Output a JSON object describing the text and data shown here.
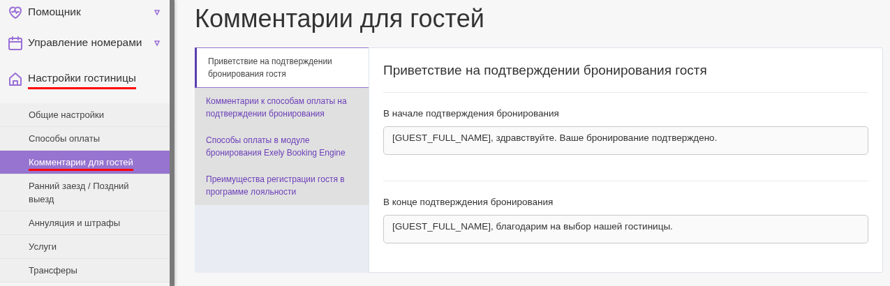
{
  "sidebar": {
    "sections": [
      {
        "label": "Помощник",
        "caret": true,
        "underlined": false
      },
      {
        "label": "Управление номерами",
        "caret": true,
        "underlined": false
      },
      {
        "label": "Настройки гостиницы",
        "caret": false,
        "underlined": true
      }
    ],
    "items": [
      {
        "label": "Общие настройки",
        "selected": false,
        "underlined": false
      },
      {
        "label": "Способы оплаты",
        "selected": false,
        "underlined": false
      },
      {
        "label": "Комментарии для гостей",
        "selected": true,
        "underlined": true
      },
      {
        "label": "Ранний заезд / Поздний выезд",
        "selected": false,
        "underlined": false
      },
      {
        "label": "Аннуляция и штрафы",
        "selected": false,
        "underlined": false
      },
      {
        "label": "Услуги",
        "selected": false,
        "underlined": false
      },
      {
        "label": "Трансферы",
        "selected": false,
        "underlined": false
      }
    ]
  },
  "page_title": "Комментарии для гостей",
  "tabs": [
    {
      "label": "Приветствие на подтверждении бронирования гостя",
      "selected": true
    },
    {
      "label": "Комментарии к способам оплаты на подтверждении бронирования",
      "selected": false
    },
    {
      "label": "Способы оплаты в модуле бронирования Exely Booking Engine",
      "selected": false
    },
    {
      "label": "Преимущества регистрации гостя в программе лояльности",
      "selected": false
    }
  ],
  "panel": {
    "title": "Приветствие на подтверждении бронирования гостя",
    "fields": [
      {
        "label": "В начале подтверждения бронирования",
        "value": "[GUEST_FULL_NAME], здравствуйте. Ваше бронирование подтверждено."
      },
      {
        "label": "В конце подтверждения бронирования",
        "value": "[GUEST_FULL_NAME], благодарим на выбор нашей гостиницы."
      }
    ]
  }
}
